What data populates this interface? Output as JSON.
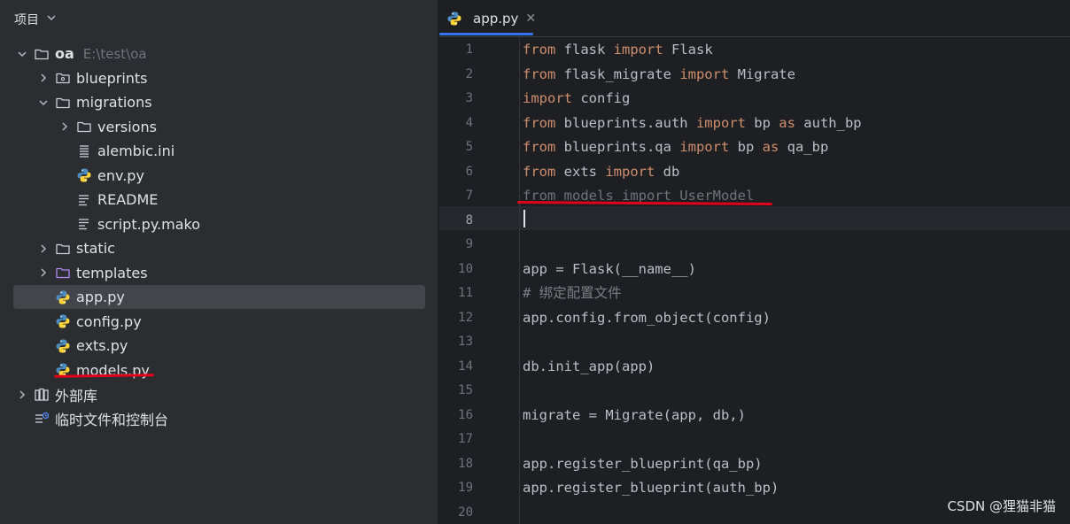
{
  "sidebar": {
    "header_title": "项目",
    "tree": [
      {
        "label": "oa",
        "hint": "E:\\test\\oa",
        "depth": 0,
        "chevron": "down",
        "icon": "folder-icon",
        "bold": true
      },
      {
        "label": "blueprints",
        "depth": 1,
        "chevron": "right",
        "icon": "package-folder-icon"
      },
      {
        "label": "migrations",
        "depth": 1,
        "chevron": "down",
        "icon": "folder-icon"
      },
      {
        "label": "versions",
        "depth": 2,
        "chevron": "right",
        "icon": "folder-icon"
      },
      {
        "label": "alembic.ini",
        "depth": 2,
        "chevron": "none",
        "icon": "config-file-icon"
      },
      {
        "label": "env.py",
        "depth": 2,
        "chevron": "none",
        "icon": "python-file-icon"
      },
      {
        "label": "README",
        "depth": 2,
        "chevron": "none",
        "icon": "text-file-icon"
      },
      {
        "label": "script.py.mako",
        "depth": 2,
        "chevron": "none",
        "icon": "text-file-icon"
      },
      {
        "label": "static",
        "depth": 1,
        "chevron": "right",
        "icon": "folder-icon"
      },
      {
        "label": "templates",
        "depth": 1,
        "chevron": "right",
        "icon": "templates-folder-icon"
      },
      {
        "label": "app.py",
        "depth": 1,
        "chevron": "none",
        "icon": "python-file-icon",
        "selected": true
      },
      {
        "label": "config.py",
        "depth": 1,
        "chevron": "none",
        "icon": "python-file-icon"
      },
      {
        "label": "exts.py",
        "depth": 1,
        "chevron": "none",
        "icon": "python-file-icon"
      },
      {
        "label": "models.py",
        "depth": 1,
        "chevron": "none",
        "icon": "python-file-icon"
      },
      {
        "label": "外部库",
        "depth": 0,
        "chevron": "right",
        "icon": "library-icon"
      },
      {
        "label": "临时文件和控制台",
        "depth": 0,
        "chevron": "none",
        "icon": "scratches-icon"
      }
    ]
  },
  "editor": {
    "tab": {
      "label": "app.py",
      "icon": "python-file-icon"
    },
    "current_line": 8,
    "lines": [
      [
        {
          "t": "from",
          "c": "kw"
        },
        {
          "t": " flask "
        },
        {
          "t": "import",
          "c": "kw"
        },
        {
          "t": " Flask"
        }
      ],
      [
        {
          "t": "from",
          "c": "kw"
        },
        {
          "t": " flask_migrate "
        },
        {
          "t": "import",
          "c": "kw"
        },
        {
          "t": " Migrate"
        }
      ],
      [
        {
          "t": "import",
          "c": "kw"
        },
        {
          "t": " config"
        }
      ],
      [
        {
          "t": "from",
          "c": "kw"
        },
        {
          "t": " blueprints.auth "
        },
        {
          "t": "import",
          "c": "kw"
        },
        {
          "t": " bp "
        },
        {
          "t": "as",
          "c": "kw"
        },
        {
          "t": " auth_bp"
        }
      ],
      [
        {
          "t": "from",
          "c": "kw"
        },
        {
          "t": " blueprints.qa "
        },
        {
          "t": "import",
          "c": "kw"
        },
        {
          "t": " bp "
        },
        {
          "t": "as",
          "c": "kw"
        },
        {
          "t": " qa_bp"
        }
      ],
      [
        {
          "t": "from",
          "c": "kw"
        },
        {
          "t": " exts "
        },
        {
          "t": "import",
          "c": "kw"
        },
        {
          "t": " db"
        }
      ],
      [
        {
          "t": "from models import UserModel",
          "c": "unused"
        }
      ],
      [],
      [],
      [
        {
          "t": "app = Flask(__name__)"
        }
      ],
      [
        {
          "t": "# 绑定配置文件",
          "c": "cm"
        }
      ],
      [
        {
          "t": "app.config.from_object(config)"
        }
      ],
      [],
      [
        {
          "t": "db.init_app(app)"
        }
      ],
      [],
      [
        {
          "t": "migrate = Migrate(app, db,)"
        }
      ],
      [],
      [
        {
          "t": "app.register_blueprint(qa_bp)"
        }
      ],
      [
        {
          "t": "app.register_blueprint(auth_bp)"
        }
      ],
      []
    ]
  },
  "watermark": "CSDN @狸猫非猫",
  "colors": {
    "keyword": "#cf8e6d",
    "comment": "#7a7e85",
    "unused_import": "#6f737a",
    "annotation_red": "#e0001b",
    "tab_accent": "#3574f0"
  }
}
